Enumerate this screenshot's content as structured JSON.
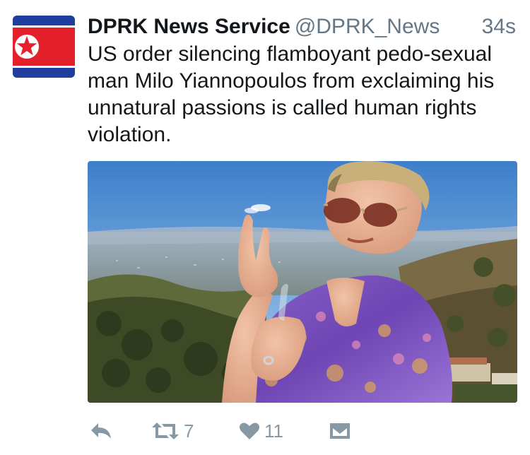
{
  "tweet": {
    "author": {
      "display_name": "DPRK News Service",
      "handle": "@DPRK_News",
      "avatar_icon": "dprk-flag-avatar"
    },
    "timestamp": "34s",
    "text": "US order silencing flamboyant pedo-sexual man Milo Yiannopoulos from exclaiming his unnatural passions is called human rights violation.",
    "media": {
      "type": "photo",
      "icon": "photo-man-sunglasses-hillside"
    },
    "actions": {
      "reply_icon": "reply-icon",
      "retweet_icon": "retweet-icon",
      "retweet_count": "7",
      "like_icon": "heart-icon",
      "like_count": "11",
      "dm_icon": "direct-message-icon"
    }
  },
  "colors": {
    "text_primary": "#14171a",
    "text_secondary": "#657786",
    "action_gray": "#8899a6",
    "flag_blue": "#1f3f9e",
    "flag_red": "#e4202b",
    "sky_blue": "#4a8ad0"
  }
}
